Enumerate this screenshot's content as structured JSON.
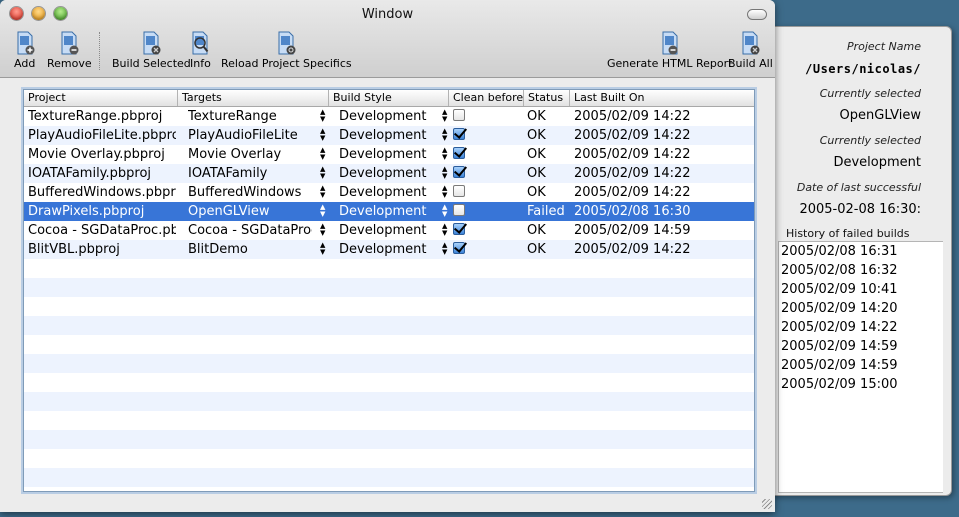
{
  "window": {
    "title": "Window"
  },
  "toolbar": {
    "add": "Add",
    "remove": "Remove",
    "build_selected": "Build Selected",
    "info": "Info",
    "reload": "Reload Project Specifics",
    "report": "Generate HTML Report",
    "build_all": "Build All"
  },
  "table": {
    "columns": [
      "Project",
      "Targets",
      "Build Style",
      "Clean before",
      "Status",
      "Last Built On"
    ],
    "rows": [
      {
        "project": "TextureRange.pbproj",
        "target": "TextureRange",
        "style": "Development",
        "clean": false,
        "status": "OK",
        "built": "2005/02/09 14:22"
      },
      {
        "project": "PlayAudioFileLite.pbproj",
        "target": "PlayAudioFileLite",
        "style": "Development",
        "clean": true,
        "status": "OK",
        "built": "2005/02/09 14:22"
      },
      {
        "project": "Movie Overlay.pbproj",
        "target": "Movie Overlay",
        "style": "Development",
        "clean": true,
        "status": "OK",
        "built": "2005/02/09 14:22"
      },
      {
        "project": "IOATAFamily.pbproj",
        "target": "IOATAFamily",
        "style": "Development",
        "clean": true,
        "status": "OK",
        "built": "2005/02/09 14:22"
      },
      {
        "project": "BufferedWindows.pbproj",
        "target": "BufferedWindows",
        "style": "Development",
        "clean": false,
        "status": "OK",
        "built": "2005/02/09 14:22"
      },
      {
        "project": "DrawPixels.pbproj",
        "target": "OpenGLView",
        "style": "Development",
        "clean": false,
        "status": "Failed",
        "built": "2005/02/08 16:30"
      },
      {
        "project": "Cocoa - SGDataProc.pbproj",
        "target": "Cocoa - SGDataProc",
        "style": "Development",
        "clean": true,
        "status": "OK",
        "built": "2005/02/09 14:59"
      },
      {
        "project": "BlitVBL.pbproj",
        "target": "BlitDemo",
        "style": "Development",
        "clean": true,
        "status": "OK",
        "built": "2005/02/09 14:22"
      }
    ],
    "selected_index": 5
  },
  "drawer": {
    "project_name_label": "Project Name",
    "project_name_value": "/Users/nicolas/",
    "target_label": "Currently selected",
    "target_value": "OpenGLView",
    "style_label": "Currently selected",
    "style_value": "Development",
    "last_success_label": "Date of last successful",
    "last_success_value": "2005-02-08 16:30:",
    "history_title": "History of failed builds",
    "history": [
      "2005/02/08 16:31",
      "2005/02/08 16:32",
      "2005/02/09 10:41",
      "2005/02/09 14:20",
      "2005/02/09 14:22",
      "2005/02/09 14:59",
      "2005/02/09 14:59",
      "2005/02/09 15:00"
    ]
  }
}
